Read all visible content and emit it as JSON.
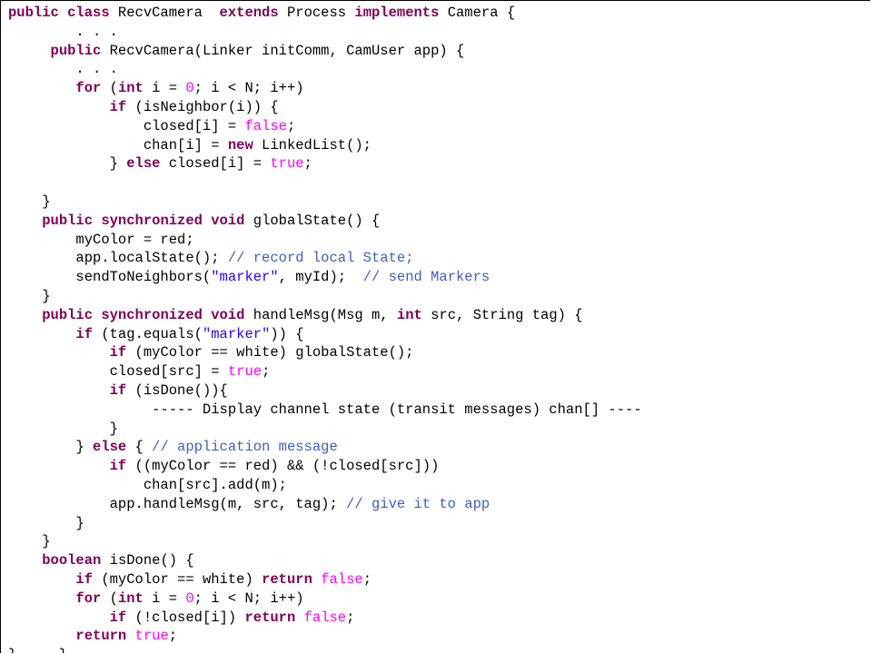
{
  "colors": {
    "keyword": "#7f0055",
    "literal": "#ff00ff",
    "string": "#2a00ff",
    "comment": "#3f5fbf",
    "text": "#000000",
    "background": "#ffffff"
  },
  "code_lines": [
    [
      [
        "kw",
        "public class"
      ],
      [
        "pl",
        " RecvCamera  "
      ],
      [
        "kw",
        "extends"
      ],
      [
        "pl",
        " Process "
      ],
      [
        "kw",
        "implements"
      ],
      [
        "pl",
        " Camera {"
      ]
    ],
    [
      [
        "pl",
        "        . . ."
      ]
    ],
    [
      [
        "pl",
        "     "
      ],
      [
        "kw",
        "public"
      ],
      [
        "pl",
        " RecvCamera(Linker initComm, CamUser app) {"
      ]
    ],
    [
      [
        "pl",
        "        . . ."
      ]
    ],
    [
      [
        "pl",
        "        "
      ],
      [
        "kw",
        "for"
      ],
      [
        "pl",
        " ("
      ],
      [
        "kw",
        "int"
      ],
      [
        "pl",
        " i = "
      ],
      [
        "lit",
        "0"
      ],
      [
        "pl",
        "; i < N; i++)"
      ]
    ],
    [
      [
        "pl",
        "            "
      ],
      [
        "kw",
        "if"
      ],
      [
        "pl",
        " (isNeighbor(i)) {"
      ]
    ],
    [
      [
        "pl",
        "                closed[i] = "
      ],
      [
        "lit",
        "false"
      ],
      [
        "pl",
        ";"
      ]
    ],
    [
      [
        "pl",
        "                chan[i] = "
      ],
      [
        "kw",
        "new"
      ],
      [
        "pl",
        " LinkedList();"
      ]
    ],
    [
      [
        "pl",
        "            } "
      ],
      [
        "kw",
        "else"
      ],
      [
        "pl",
        " closed[i] = "
      ],
      [
        "lit",
        "true"
      ],
      [
        "pl",
        ";"
      ]
    ],
    [
      [
        "pl",
        ""
      ]
    ],
    [
      [
        "pl",
        "    }"
      ]
    ],
    [
      [
        "pl",
        "    "
      ],
      [
        "kw",
        "public synchronized void"
      ],
      [
        "pl",
        " globalState() {"
      ]
    ],
    [
      [
        "pl",
        "        myColor = red;"
      ]
    ],
    [
      [
        "pl",
        "        app.localState(); "
      ],
      [
        "cm",
        "// record local State;"
      ]
    ],
    [
      [
        "pl",
        "        sendToNeighbors("
      ],
      [
        "str",
        "\"marker\""
      ],
      [
        "pl",
        ", myId);  "
      ],
      [
        "cm",
        "// send Markers"
      ]
    ],
    [
      [
        "pl",
        "    }"
      ]
    ],
    [
      [
        "pl",
        "    "
      ],
      [
        "kw",
        "public synchronized void"
      ],
      [
        "pl",
        " handleMsg(Msg m, "
      ],
      [
        "kw",
        "int"
      ],
      [
        "pl",
        " src, String tag) {"
      ]
    ],
    [
      [
        "pl",
        "        "
      ],
      [
        "kw",
        "if"
      ],
      [
        "pl",
        " (tag.equals("
      ],
      [
        "str",
        "\"marker\""
      ],
      [
        "pl",
        ")) {"
      ]
    ],
    [
      [
        "pl",
        "            "
      ],
      [
        "kw",
        "if"
      ],
      [
        "pl",
        " (myColor == white) globalState();"
      ]
    ],
    [
      [
        "pl",
        "            closed[src] = "
      ],
      [
        "lit",
        "true"
      ],
      [
        "pl",
        ";"
      ]
    ],
    [
      [
        "pl",
        "            "
      ],
      [
        "kw",
        "if"
      ],
      [
        "pl",
        " (isDone()){"
      ]
    ],
    [
      [
        "pl",
        "                 ----- Display channel state (transit messages) chan[] ----"
      ]
    ],
    [
      [
        "pl",
        "            }"
      ]
    ],
    [
      [
        "pl",
        "        } "
      ],
      [
        "kw",
        "else"
      ],
      [
        "pl",
        " { "
      ],
      [
        "cm",
        "// application message"
      ]
    ],
    [
      [
        "pl",
        "            "
      ],
      [
        "kw",
        "if"
      ],
      [
        "pl",
        " ((myColor == red) && (!closed[src]))"
      ]
    ],
    [
      [
        "pl",
        "                chan[src].add(m);"
      ]
    ],
    [
      [
        "pl",
        "            app.handleMsg(m, src, tag); "
      ],
      [
        "cm",
        "// give it to app"
      ]
    ],
    [
      [
        "pl",
        "        }"
      ]
    ],
    [
      [
        "pl",
        "    }"
      ]
    ],
    [
      [
        "pl",
        "    "
      ],
      [
        "kw",
        "boolean"
      ],
      [
        "pl",
        " isDone() {"
      ]
    ],
    [
      [
        "pl",
        "        "
      ],
      [
        "kw",
        "if"
      ],
      [
        "pl",
        " (myColor == white) "
      ],
      [
        "kw",
        "return"
      ],
      [
        "pl",
        " "
      ],
      [
        "lit",
        "false"
      ],
      [
        "pl",
        ";"
      ]
    ],
    [
      [
        "pl",
        "        "
      ],
      [
        "kw",
        "for"
      ],
      [
        "pl",
        " ("
      ],
      [
        "kw",
        "int"
      ],
      [
        "pl",
        " i = "
      ],
      [
        "lit",
        "0"
      ],
      [
        "pl",
        "; i < N; i++)"
      ]
    ],
    [
      [
        "pl",
        "            "
      ],
      [
        "kw",
        "if"
      ],
      [
        "pl",
        " (!closed[i]) "
      ],
      [
        "kw",
        "return"
      ],
      [
        "pl",
        " "
      ],
      [
        "lit",
        "false"
      ],
      [
        "pl",
        ";"
      ]
    ],
    [
      [
        "pl",
        "        "
      ],
      [
        "kw",
        "return"
      ],
      [
        "pl",
        " "
      ],
      [
        "lit",
        "true"
      ],
      [
        "pl",
        ";"
      ]
    ],
    [
      [
        "pl",
        "}     }"
      ]
    ]
  ]
}
